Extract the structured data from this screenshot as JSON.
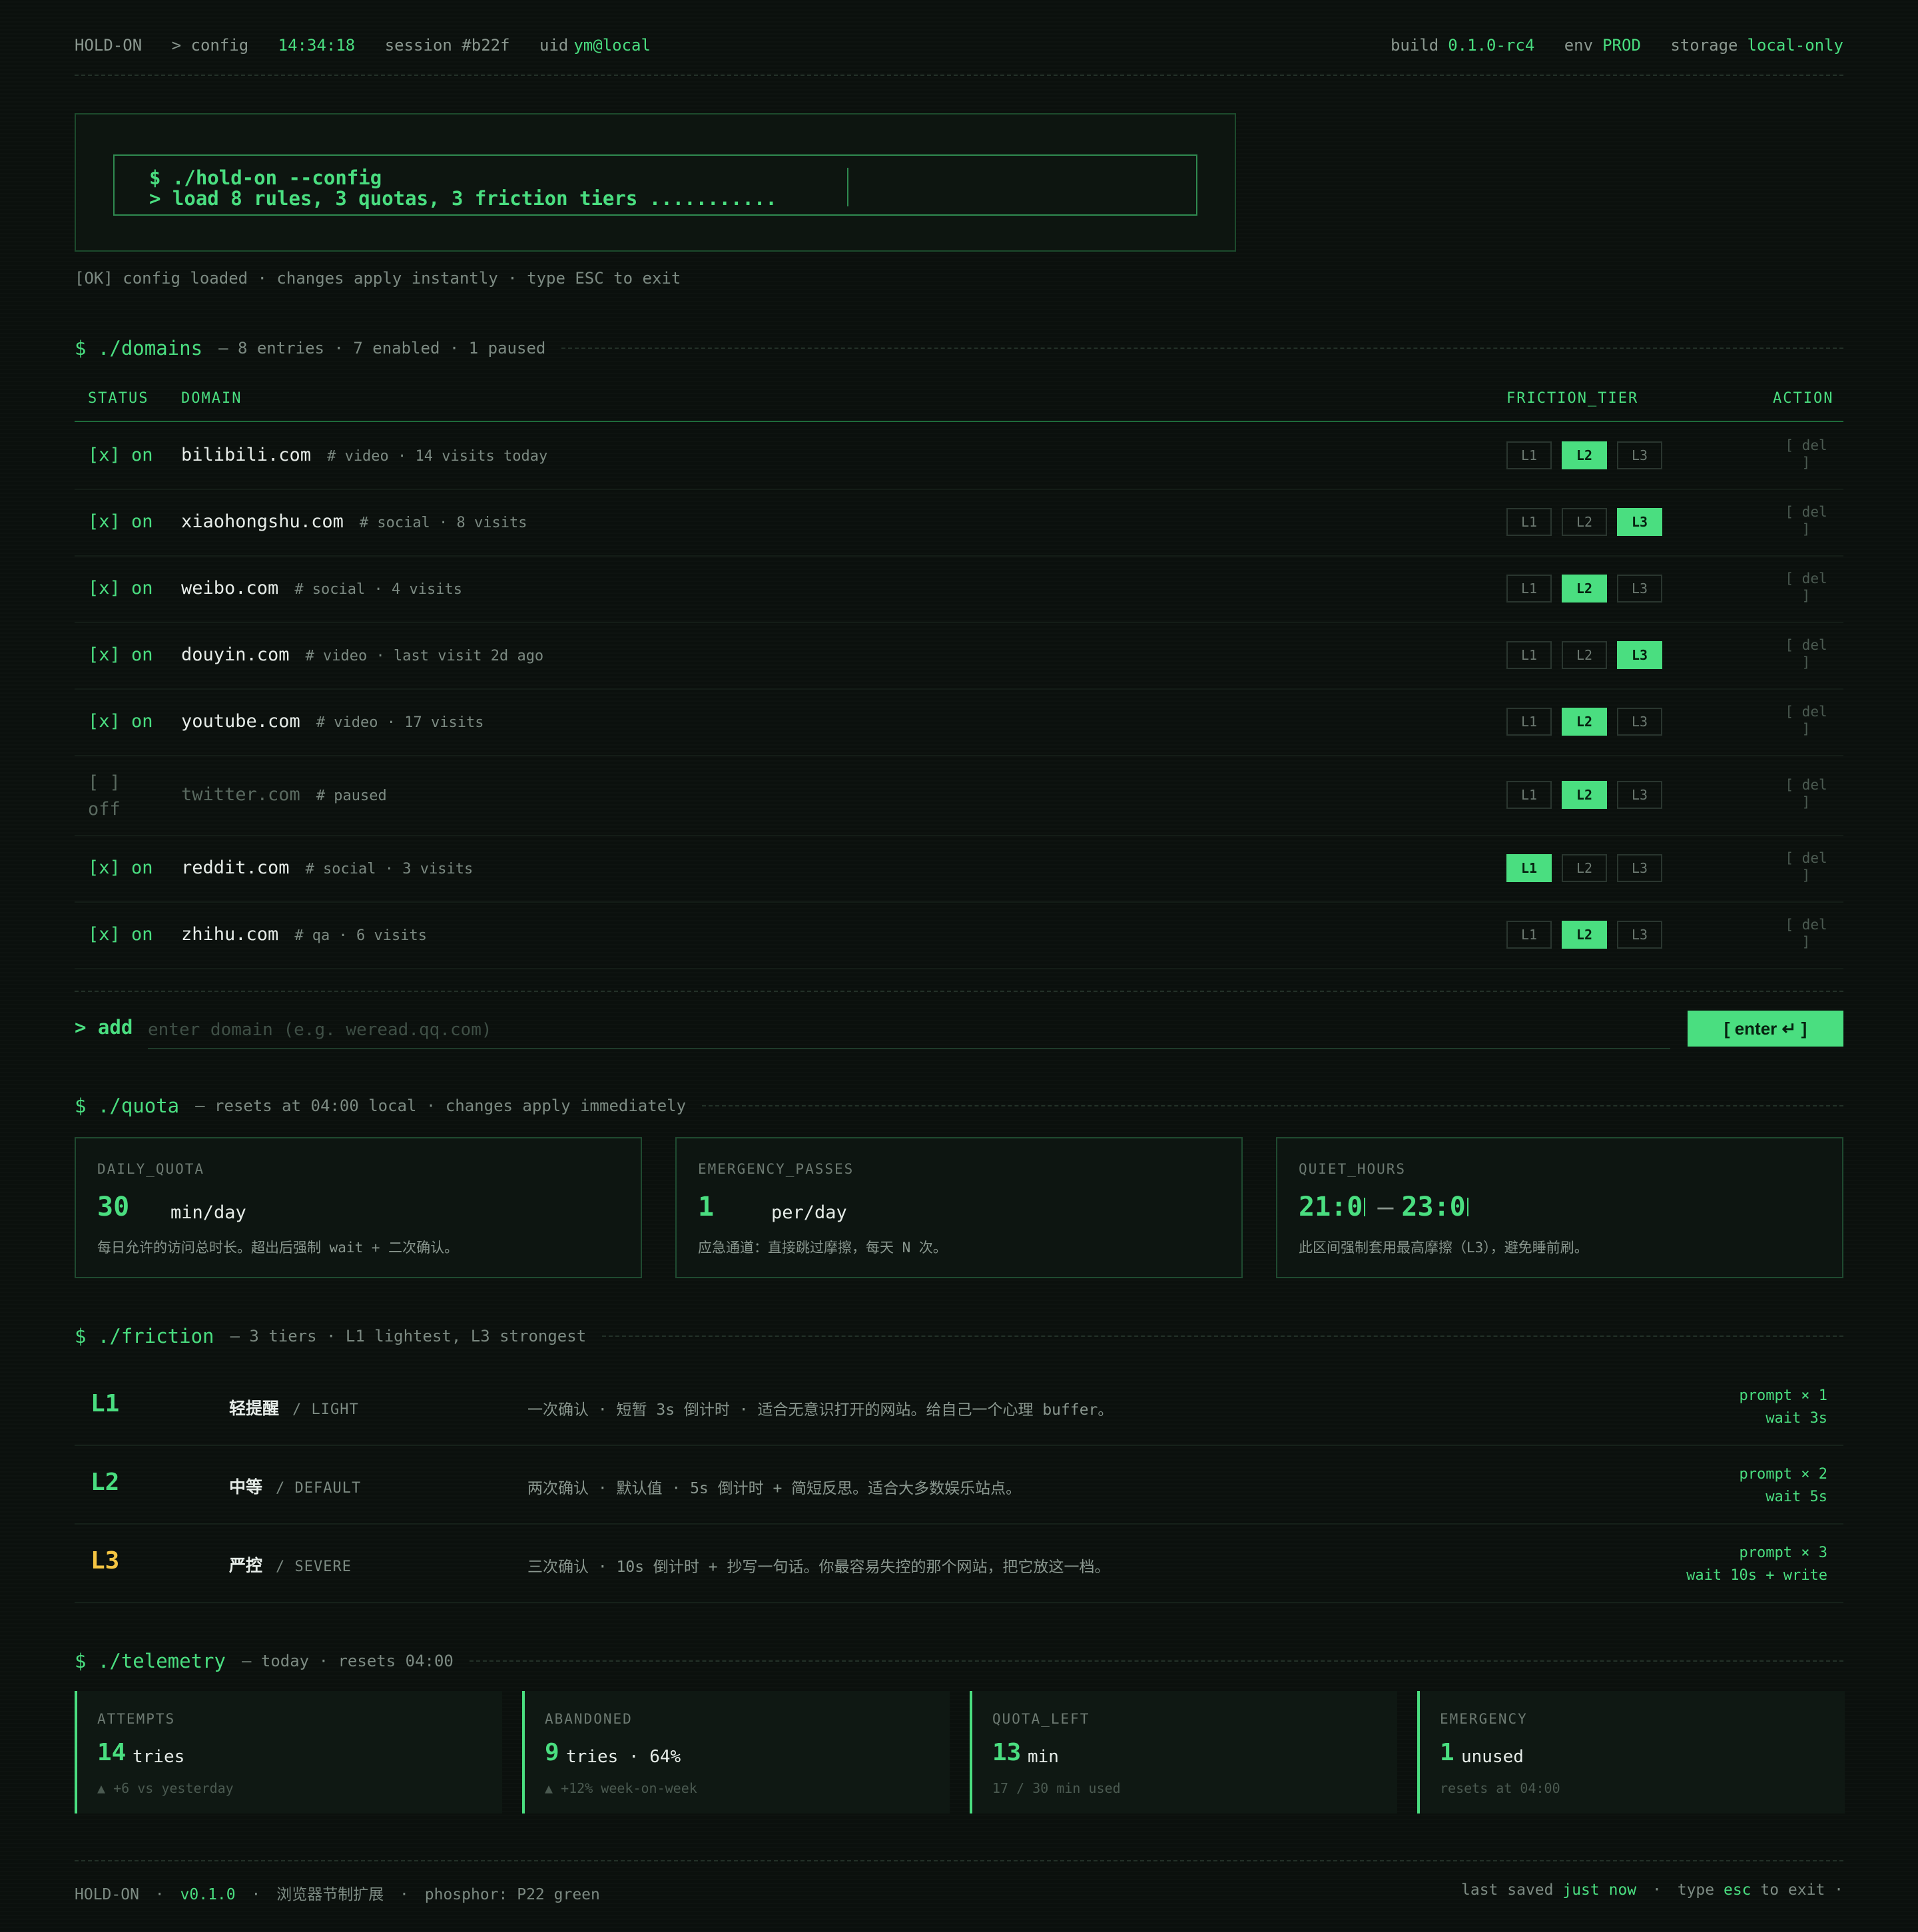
{
  "topbar": {
    "app": "HOLD-ON",
    "path": "> config",
    "time": "14:34:18",
    "session": "session #b22f",
    "uid_label": "uid",
    "uid": "ym@local",
    "build_label": "build",
    "build": "0.1.0-rc4",
    "env_label": "env",
    "env": "PROD",
    "storage_label": "storage",
    "storage": "local-only"
  },
  "terminal": {
    "line1": "$ ./hold-on --config",
    "line2": "> load 8 rules, 3 quotas, 3 friction tiers ..........."
  },
  "status_line": "[OK] config loaded · changes apply instantly · type ESC to exit",
  "domains": {
    "cmd": "$ ./domains",
    "meta": "— 8 entries · 7 enabled · 1 paused",
    "headers": {
      "status": "STATUS",
      "domain": "DOMAIN",
      "tier": "FRICTION_TIER",
      "action": "ACTION"
    },
    "tier_labels": [
      "L1",
      "L2",
      "L3"
    ],
    "del_label": "[ del ]",
    "rows": [
      {
        "status": "[x] on",
        "domain": "bilibili.com",
        "note": "# video · 14 visits today",
        "tier": "L2",
        "enabled": true
      },
      {
        "status": "[x] on",
        "domain": "xiaohongshu.com",
        "note": "# social · 8 visits",
        "tier": "L3",
        "enabled": true
      },
      {
        "status": "[x] on",
        "domain": "weibo.com",
        "note": "# social · 4 visits",
        "tier": "L2",
        "enabled": true
      },
      {
        "status": "[x] on",
        "domain": "douyin.com",
        "note": "# video · last visit 2d ago",
        "tier": "L3",
        "enabled": true
      },
      {
        "status": "[x] on",
        "domain": "youtube.com",
        "note": "# video · 17 visits",
        "tier": "L2",
        "enabled": true
      },
      {
        "status": "[ ] off",
        "domain": "twitter.com",
        "note": "# paused",
        "tier": "L2",
        "enabled": false
      },
      {
        "status": "[x] on",
        "domain": "reddit.com",
        "note": "# social · 3 visits",
        "tier": "L1",
        "enabled": true
      },
      {
        "status": "[x] on",
        "domain": "zhihu.com",
        "note": "# qa · 6 visits",
        "tier": "L2",
        "enabled": true
      }
    ]
  },
  "add": {
    "label": "> add",
    "placeholder": "enter domain (e.g. weread.qq.com)",
    "button": "[ enter ↵ ]"
  },
  "quota": {
    "cmd": "$ ./quota",
    "meta": "— resets at 04:00 local · changes apply immediately",
    "cards": [
      {
        "label": "DAILY_QUOTA",
        "value": "30",
        "unit": "min/day",
        "desc": "每日允许的访问总时长。超出后强制 wait + 二次确认。"
      },
      {
        "label": "EMERGENCY_PASSES",
        "value": "1",
        "unit": "per/day",
        "desc": "应急通道：直接跳过摩擦，每天 N 次。"
      },
      {
        "label": "QUIET_HOURS",
        "start": "21:0",
        "sep": "—",
        "end": "23:0",
        "desc": "此区间强制套用最高摩擦（L3），避免睡前刷。"
      }
    ]
  },
  "friction": {
    "cmd": "$ ./friction",
    "meta": "— 3 tiers · L1 lightest, L3 strongest",
    "tiers": [
      {
        "level": "L1",
        "name": "轻提醒",
        "tag": "/ LIGHT",
        "desc": "一次确认 · 短暂 3s 倒计时 · 适合无意识打开的网站。给自己一个心理 buffer。",
        "prompt": "prompt × 1",
        "wait": "wait 3s",
        "color": "#4ade80"
      },
      {
        "level": "L2",
        "name": "中等",
        "tag": "/ DEFAULT",
        "desc": "两次确认 · 默认值 · 5s 倒计时 + 简短反思。适合大多数娱乐站点。",
        "prompt": "prompt × 2",
        "wait": "wait 5s",
        "color": "#4ade80"
      },
      {
        "level": "L3",
        "name": "严控",
        "tag": "/ SEVERE",
        "desc": "三次确认 · 10s 倒计时 + 抄写一句话。你最容易失控的那个网站，把它放这一档。",
        "prompt": "prompt × 3",
        "wait": "wait 10s + write",
        "color": "#f5c542"
      }
    ]
  },
  "telemetry": {
    "cmd": "$ ./telemetry",
    "meta": "— today · resets 04:00",
    "cards": [
      {
        "label": "ATTEMPTS",
        "value": "14",
        "unit": "tries",
        "sub": "▲ +6 vs yesterday"
      },
      {
        "label": "ABANDONED",
        "value": "9",
        "unit": "tries · 64%",
        "sub": "▲ +12% week-on-week"
      },
      {
        "label": "QUOTA_LEFT",
        "value": "13",
        "unit": "min",
        "sub": "17 / 30 min used"
      },
      {
        "label": "EMERGENCY",
        "value": "1",
        "unit": "unused",
        "sub": "resets at 04:00"
      }
    ]
  },
  "footer": {
    "app": "HOLD-ON",
    "dot": "·",
    "version": "v0.1.0",
    "desc": "浏览器节制扩展",
    "phosphor": "phosphor: P22 green",
    "saved_label": "last saved",
    "saved": "just now",
    "type_label": "type",
    "esc": "esc",
    "exit_label": "to exit ·"
  },
  "colors": {
    "accent": "#4ade80",
    "background": "#0b100d",
    "warning": "#f5c542"
  }
}
